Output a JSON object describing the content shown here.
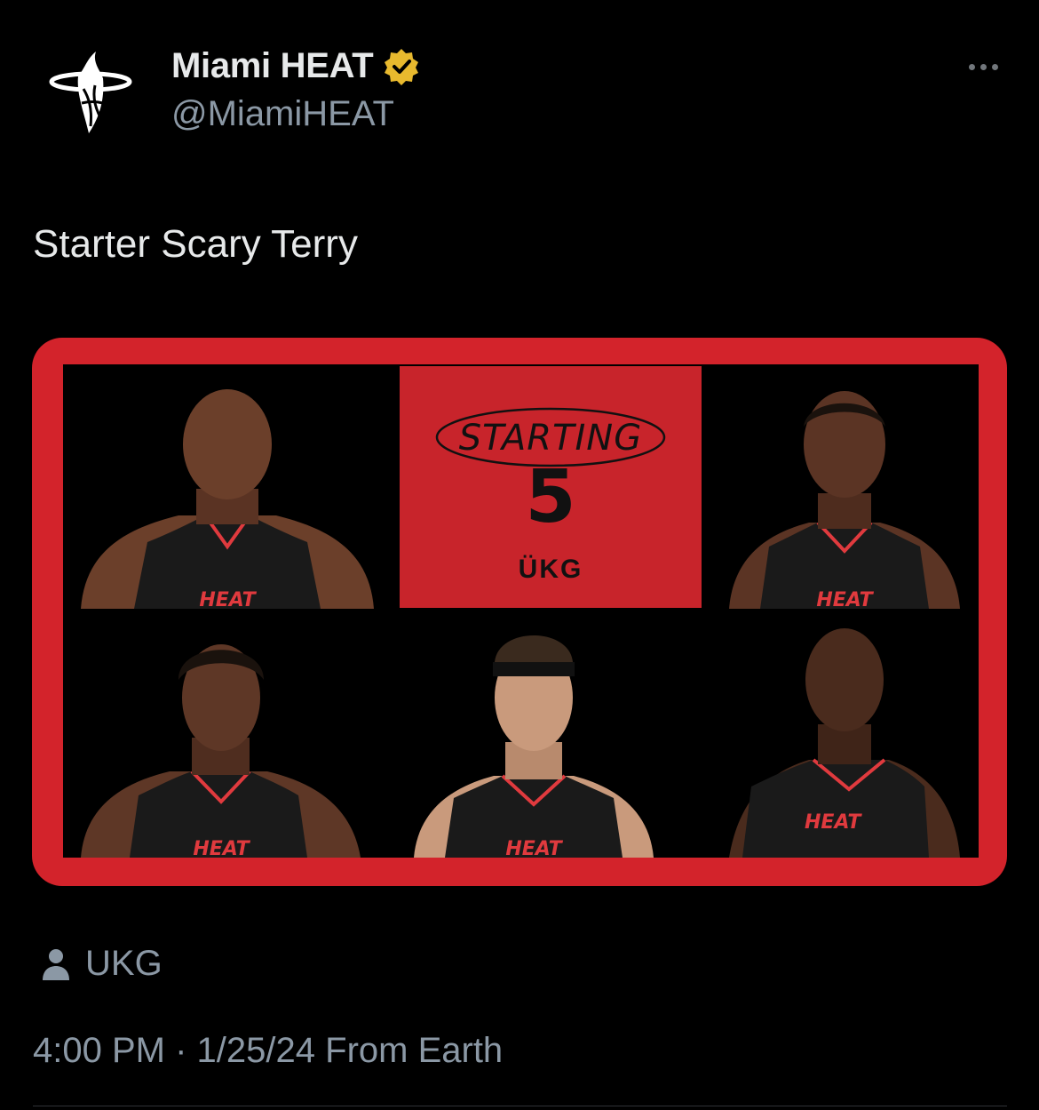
{
  "account": {
    "display_name": "Miami HEAT",
    "handle": "@MiamiHEAT",
    "avatar_icon": "heat-logo-icon",
    "verified_icon": "verified-badge-icon"
  },
  "tweet": {
    "text": "Starter Scary Terry"
  },
  "media": {
    "headline": "STARTING",
    "number": "5",
    "sponsor_logo_text": "ÜKG",
    "jersey_text": "HEAT",
    "colors": {
      "frame": "#d3232b",
      "tile_red": "#c8242b",
      "jersey": "#1a1a1a",
      "jersey_trim": "#e03a3e"
    }
  },
  "sponsor": {
    "icon": "person-icon",
    "name": "UKG"
  },
  "meta": {
    "time": "4:00 PM",
    "separator": "·",
    "date": "1/25/24",
    "source": "From Earth"
  }
}
